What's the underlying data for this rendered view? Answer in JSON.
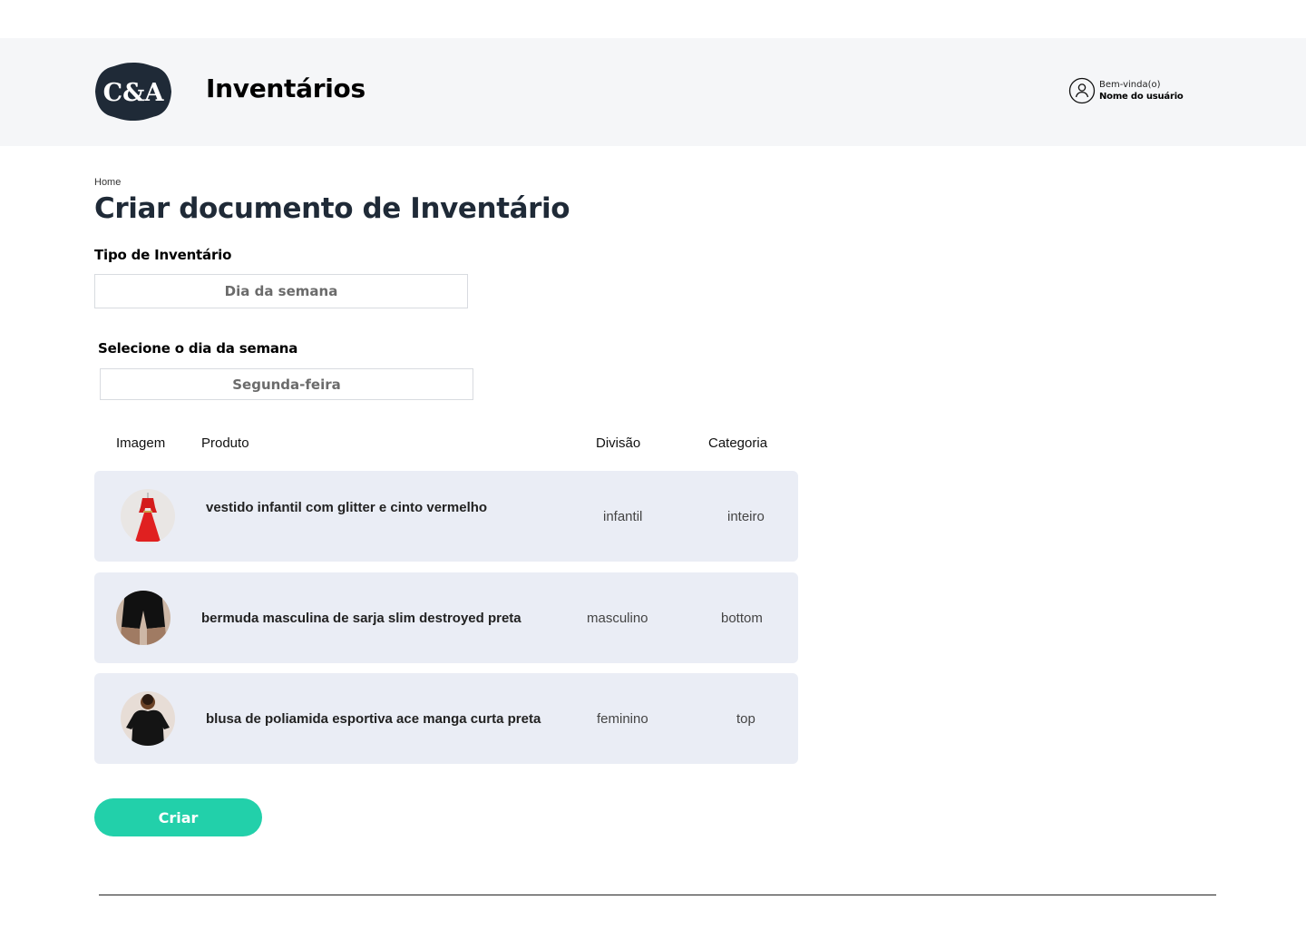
{
  "header": {
    "logo_text": "C&A",
    "app_title": "Inventários",
    "user": {
      "greeting": "Bem-vinda(o)",
      "name": "Nome do usuário",
      "icon": "user-circle-icon"
    }
  },
  "breadcrumb": "Home",
  "page_title": "Criar documento de Inventário",
  "form": {
    "inventory_type": {
      "label": "Tipo de Inventário",
      "value": "Dia da semana"
    },
    "weekday": {
      "label": "Selecione o dia da semana",
      "value": "Segunda-feira"
    }
  },
  "table": {
    "columns": [
      "Imagem",
      "Produto",
      "Divisão",
      "Categoria"
    ],
    "rows": [
      {
        "image": "red-dress-image",
        "product": "vestido infantil com glitter e cinto vermelho",
        "division": "infantil",
        "category": "inteiro"
      },
      {
        "image": "black-shorts-image",
        "product": "bermuda masculina de sarja slim destroyed preta",
        "division": "masculino",
        "category": "bottom"
      },
      {
        "image": "black-blouse-image",
        "product": "blusa de poliamida esportiva ace manga curta preta",
        "division": "feminino",
        "category": "top"
      }
    ]
  },
  "actions": {
    "create_label": "Criar"
  },
  "colors": {
    "header_bg": "#f5f6f8",
    "row_bg": "#eaedf5",
    "accent": "#22d0aa",
    "logo_bg": "#1f2a37"
  }
}
